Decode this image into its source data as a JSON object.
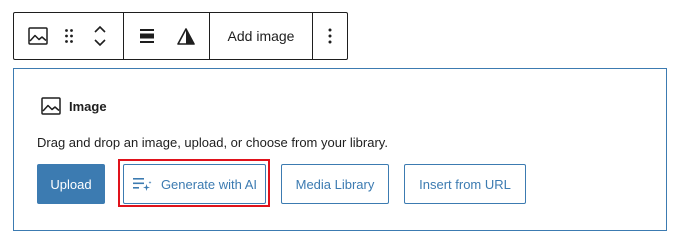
{
  "toolbar": {
    "buttons": [
      {
        "icon": "image-icon"
      },
      {
        "icon": "drag-handle-icon"
      },
      {
        "icon": "move-up-down-icon"
      },
      {
        "icon": "align-icon"
      },
      {
        "icon": "duotone-icon"
      }
    ],
    "add_image_label": "Add image",
    "more_options_icon": "vertical-ellipsis-icon"
  },
  "block": {
    "icon": "image-icon",
    "title": "Image",
    "instructions": "Drag and drop an image, upload, or choose from your library.",
    "buttons": {
      "upload": "Upload",
      "generate_ai": "Generate with AI",
      "media_library": "Media Library",
      "insert_url": "Insert from URL"
    }
  },
  "colors": {
    "accent": "#3c7bb1",
    "text": "#1e1e1e",
    "highlight": "#e0121b"
  }
}
